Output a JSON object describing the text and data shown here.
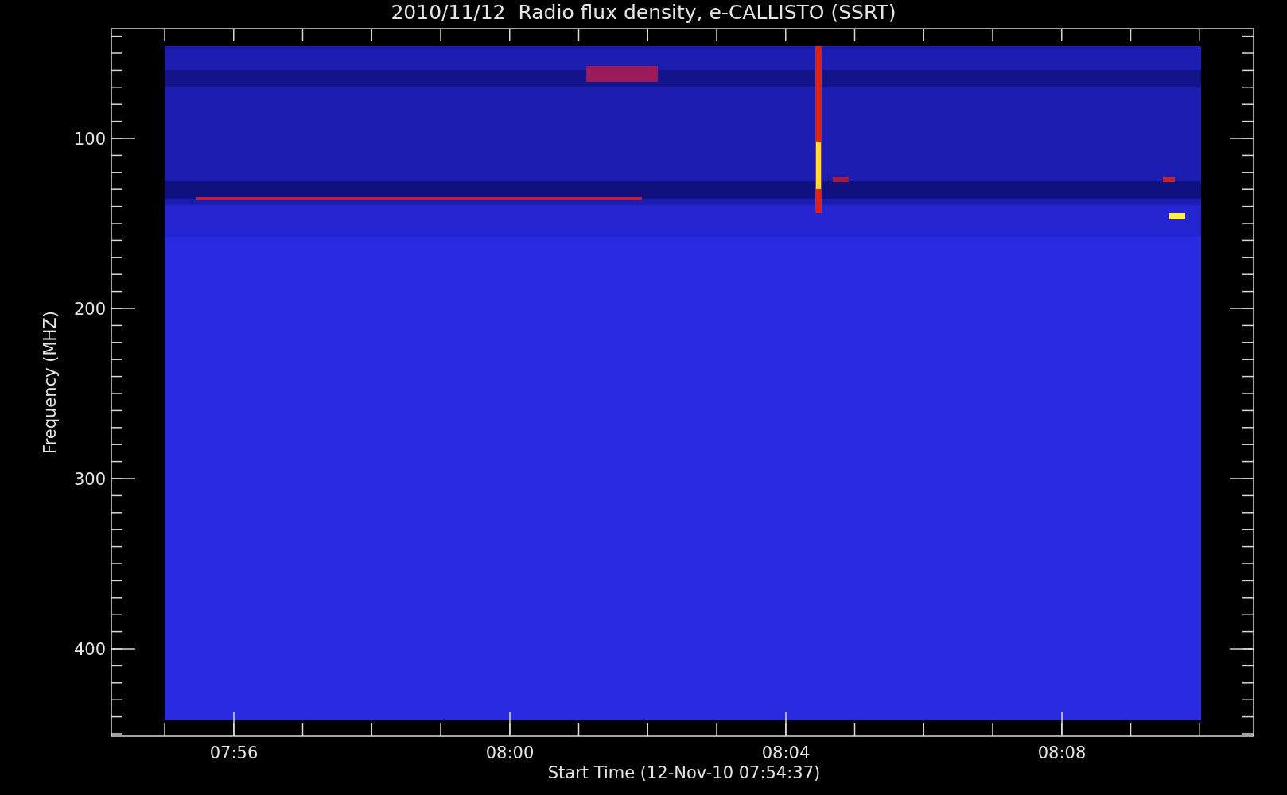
{
  "plot": {
    "title": "2010/11/12  Radio flux density, e-CALLISTO (SSRT)",
    "ylabel": "Frequency (MHZ)",
    "xlabel": "Start Time (12-Nov-10 07:54:37)",
    "yticks": [
      "100",
      "200",
      "300",
      "400"
    ],
    "xticks": [
      "07:56",
      "08:00",
      "08:04",
      "08:08"
    ]
  }
}
